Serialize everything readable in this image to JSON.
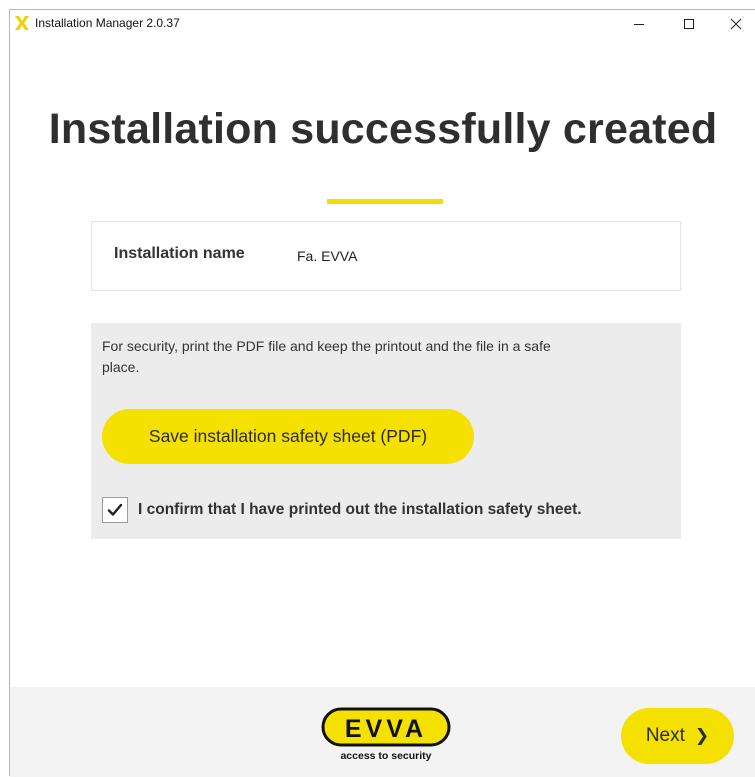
{
  "window": {
    "title": "Installation Manager 2.0.37",
    "icon": "evva-x-icon"
  },
  "page": {
    "heading": "Installation successfully created"
  },
  "installation": {
    "name_label": "Installation name",
    "name_value": "Fa. EVVA"
  },
  "security": {
    "message": "For security, print the PDF file and keep the printout and the file in a safe place.",
    "save_button_label": "Save installation safety sheet (PDF)",
    "confirm_checked": true,
    "confirm_label": "I confirm that I have printed out the installation safety sheet."
  },
  "footer": {
    "logo_text": "EVVA",
    "logo_tagline": "access to security",
    "next_label": "Next",
    "next_icon": "chevron-right-icon"
  },
  "colors": {
    "accent": "#f5e100",
    "panel": "#ececec",
    "footer": "#f3f3f3"
  }
}
